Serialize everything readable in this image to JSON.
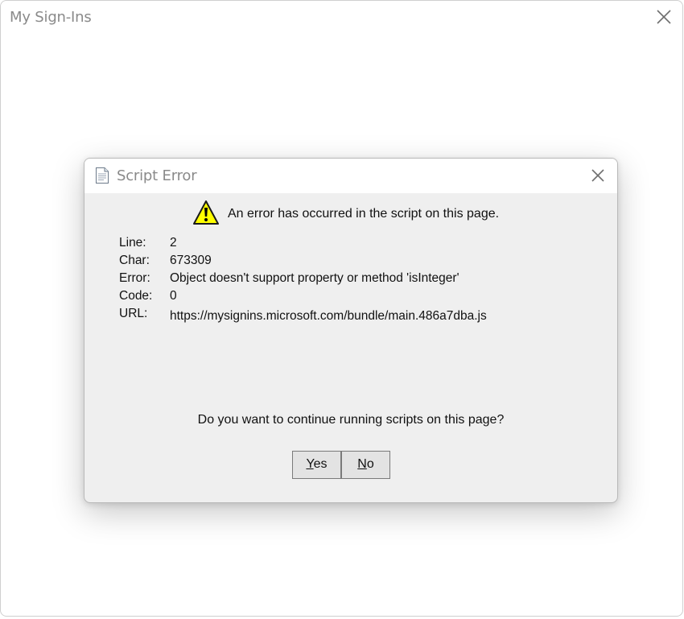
{
  "outer_window": {
    "title": "My Sign-Ins"
  },
  "dialog": {
    "title": "Script Error",
    "heading": "An error has occurred in the script on this page.",
    "details": [
      {
        "label": "Line:",
        "value": "2"
      },
      {
        "label": "Char:",
        "value": "673309"
      },
      {
        "label": "Error:",
        "value": "Object doesn't support property or method 'isInteger'"
      },
      {
        "label": "Code:",
        "value": "0"
      },
      {
        "label": "URL:",
        "value": "https://mysignins.microsoft.com/bundle/main.486a7dba.js"
      }
    ],
    "question": "Do you want to continue running scripts on this page?",
    "yes_button": {
      "access_key": "Y",
      "rest": "es"
    },
    "no_button": {
      "access_key": "N",
      "rest": "o"
    }
  },
  "icons": {
    "outer_close": "close-icon",
    "dialog_close": "close-icon",
    "document": "document-icon",
    "warning": "warning-icon"
  },
  "colors": {
    "warning_fill": "#ffff00",
    "dialog_background": "#efefef",
    "titlebar_background": "#ffffff"
  }
}
